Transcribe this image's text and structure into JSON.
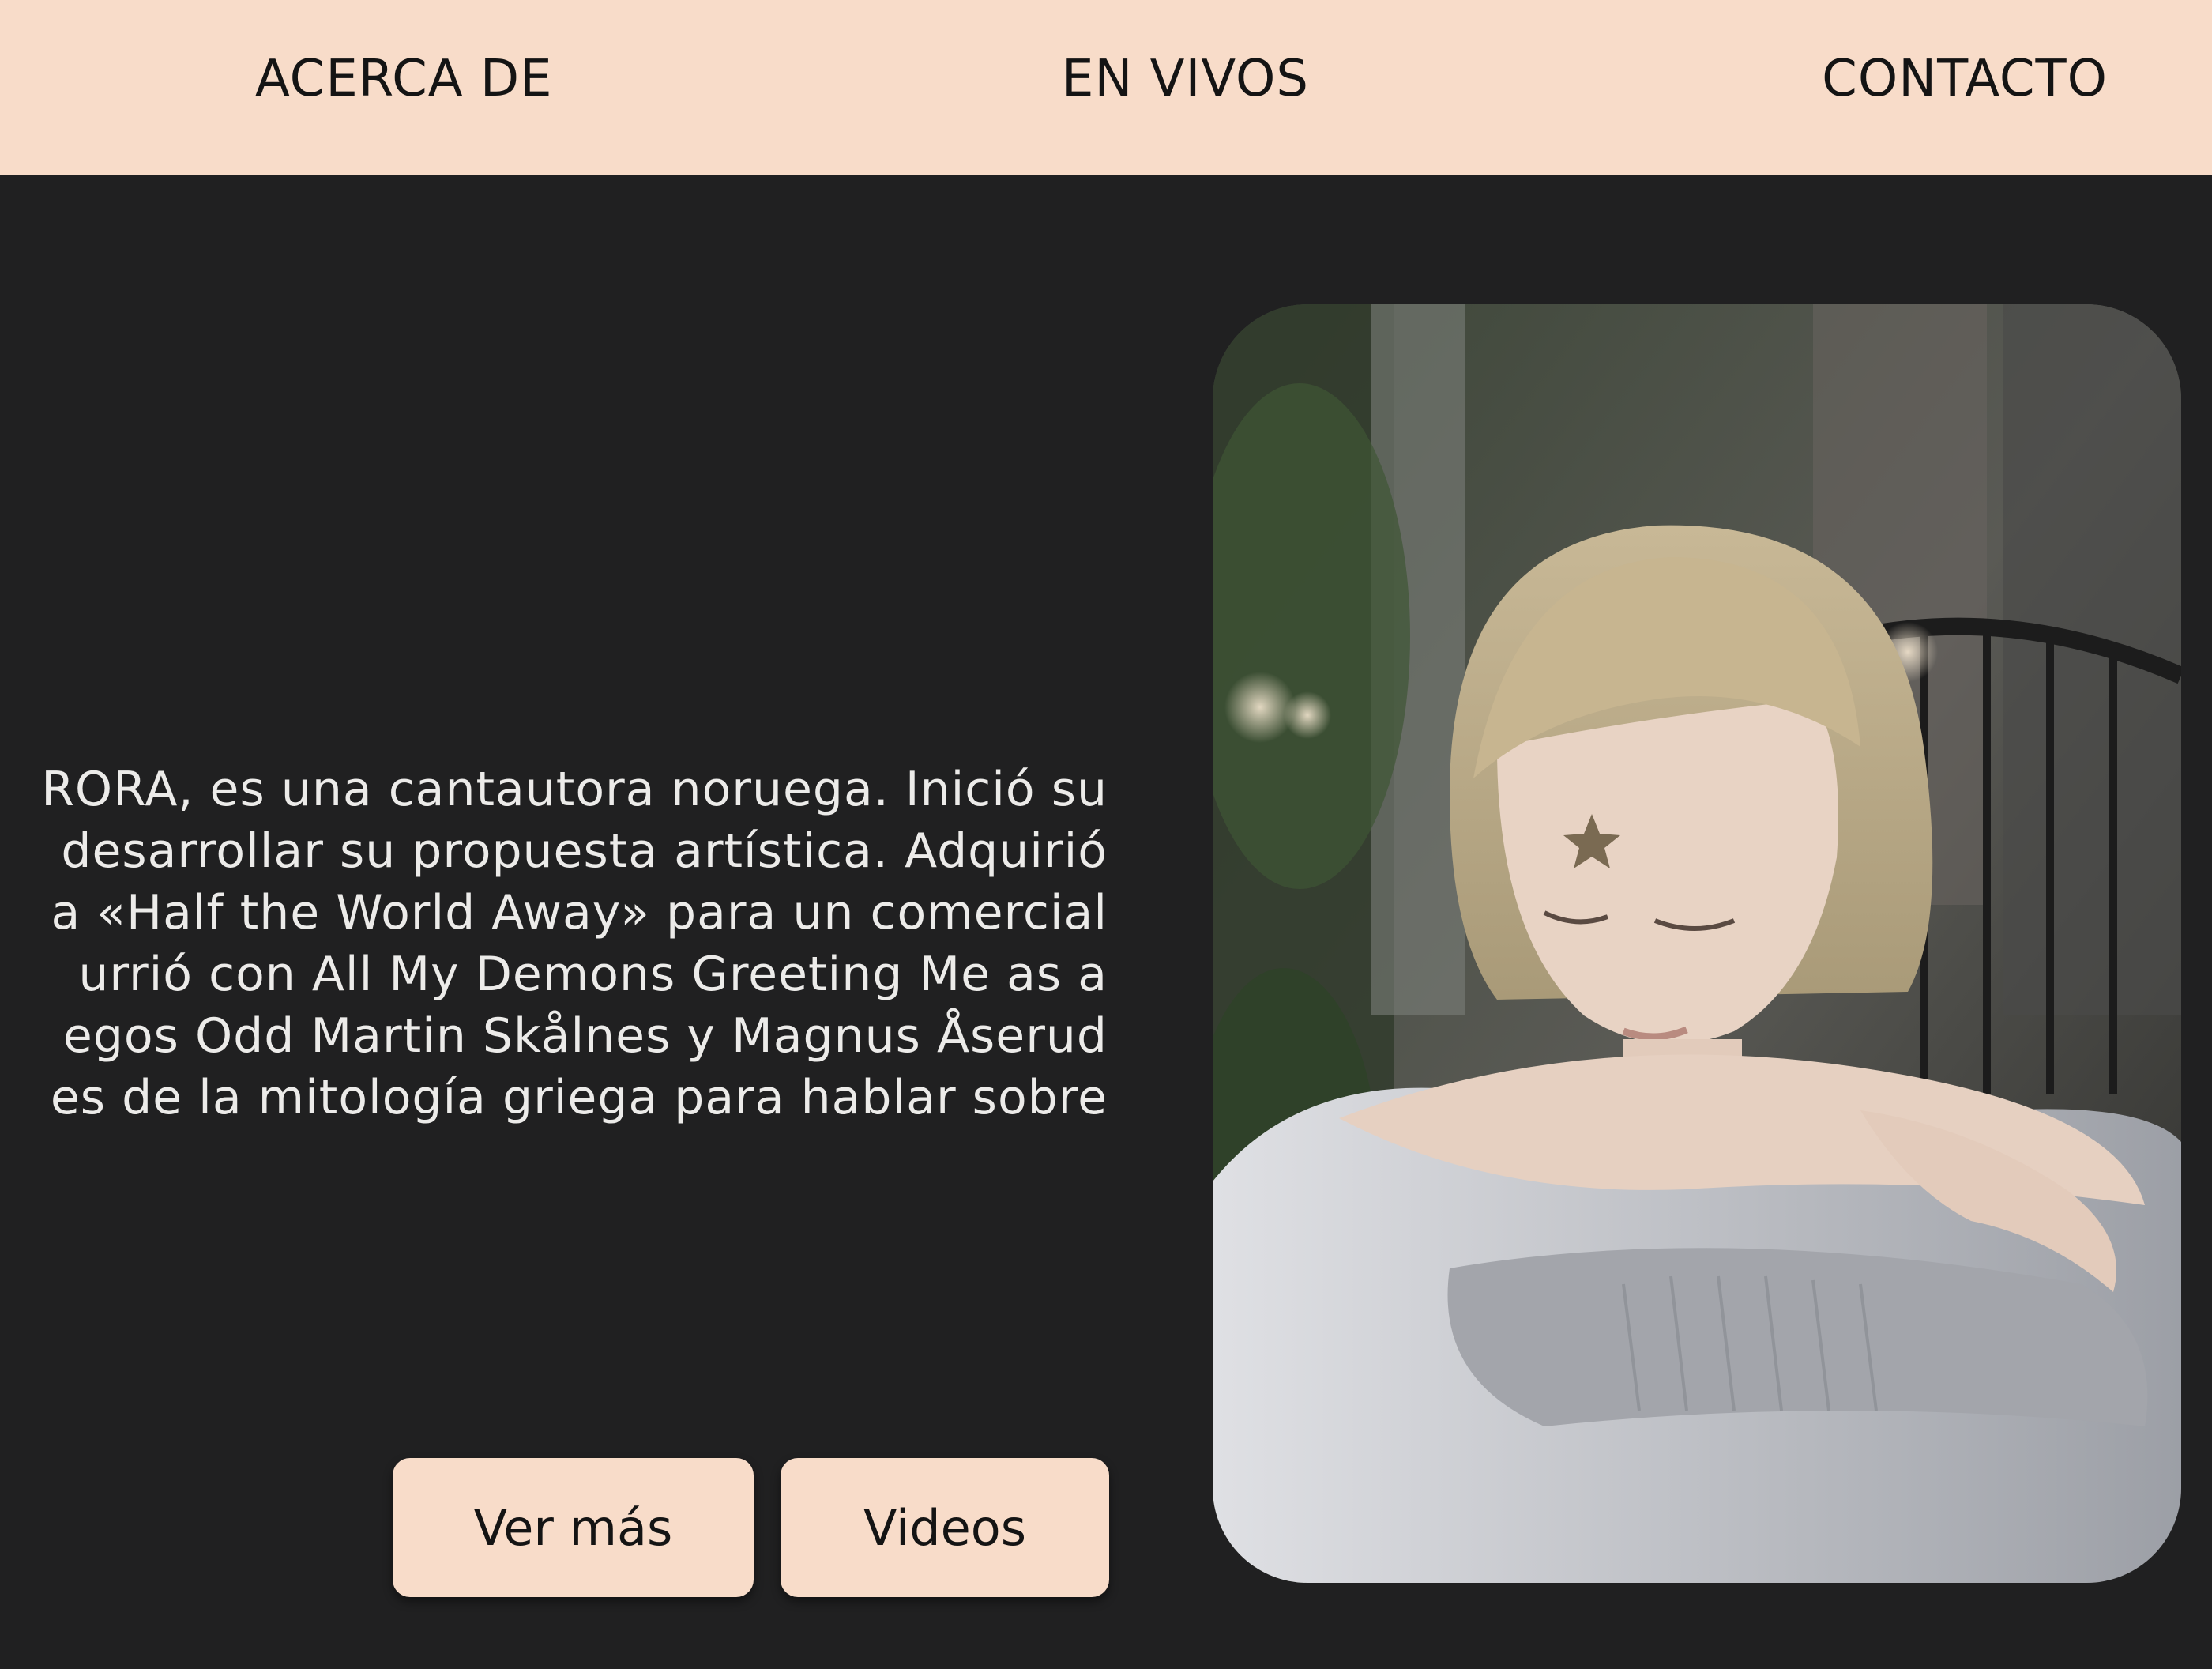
{
  "nav": {
    "items": [
      "ACERCA DE",
      "EN VIVOS",
      "CONTACTO"
    ]
  },
  "bio": {
    "lines": [
      "RORA, es una cantautora noruega. Inició su",
      "desarrollar su propuesta artística. Adquirió",
      "a «Half the World Away» para un comercial",
      "urrió con All My Demons Greeting Me as a",
      "egos Odd Martin Skålnes y Magnus Åserud",
      "es de la mitología griega para hablar sobre"
    ]
  },
  "buttons": {
    "more_label": "Ver más",
    "videos_label": "Videos"
  },
  "colors": {
    "nav_bg": "#f8dcc9",
    "page_bg": "#202021",
    "text_light": "#ecebe9",
    "text_dark": "#141414"
  }
}
